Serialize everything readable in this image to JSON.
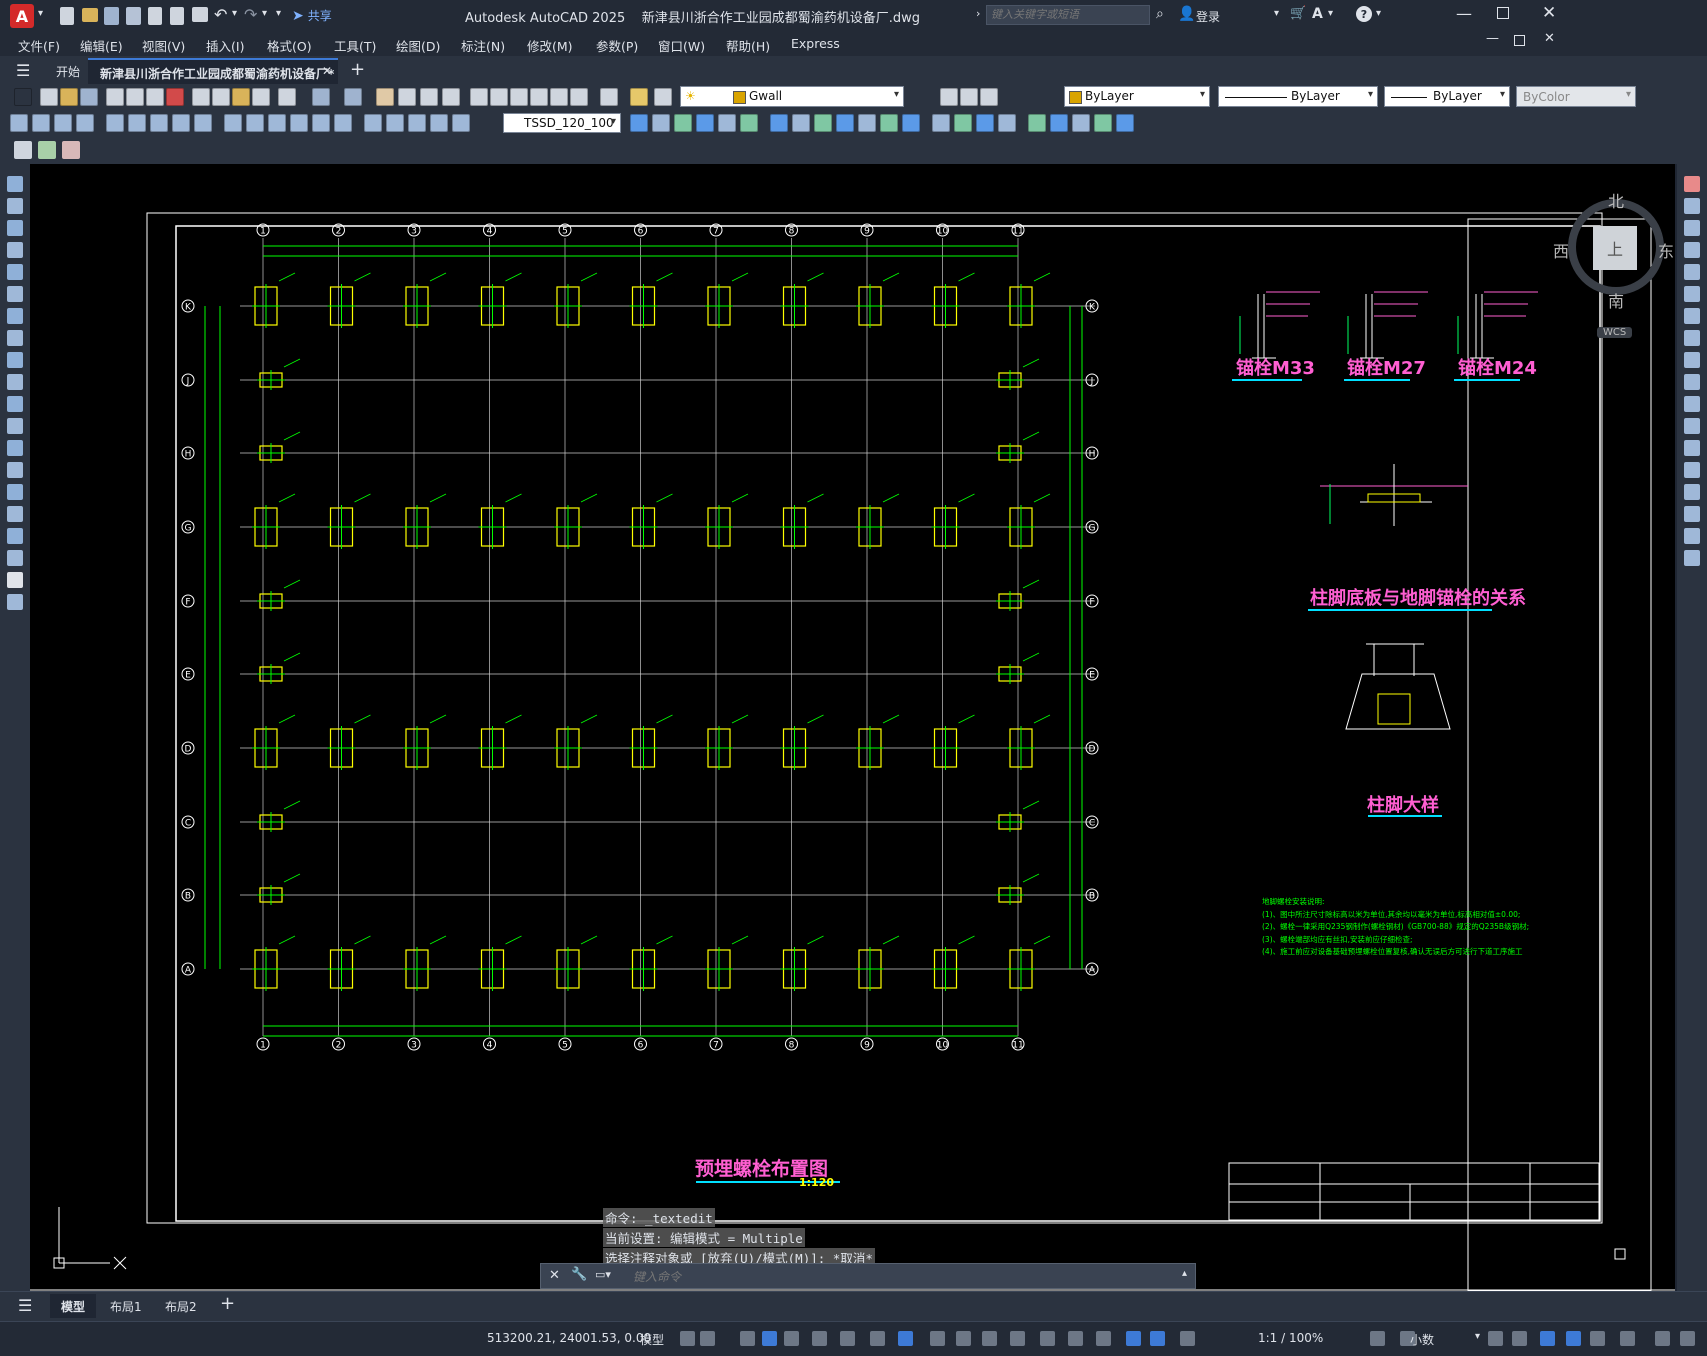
{
  "app": {
    "logo_letter": "A",
    "share_label": "共享",
    "title": "Autodesk AutoCAD 2025    新津县川浙合作工业园成都蜀渝药机设备厂.dwg",
    "search_placeholder": "键入关键字或短语",
    "login_label": "登录"
  },
  "menu": [
    "文件(F)",
    "编辑(E)",
    "视图(V)",
    "插入(I)",
    "格式(O)",
    "工具(T)",
    "绘图(D)",
    "标注(N)",
    "修改(M)",
    "参数(P)",
    "窗口(W)",
    "帮助(H)",
    "Express"
  ],
  "tabs": {
    "start": "开始",
    "doc": "新津县川浙合作工业园成都蜀渝药机设备厂*"
  },
  "toolbar": {
    "layer_name": "Gwall",
    "color": "ByLayer",
    "linetype": "ByLayer",
    "lineweight": "ByLayer",
    "plotstyle": "ByColor",
    "dimstyle": "TSSD_120_100"
  },
  "viewcube": {
    "north": "北",
    "south": "南",
    "east": "东",
    "west": "西",
    "top": "上",
    "wcs": "WCS"
  },
  "drawing": {
    "main_title": "预埋螺栓布置图",
    "main_scale": "1:120",
    "anchor_titles": [
      "锚栓M33",
      "锚栓M27",
      "锚栓M24"
    ],
    "detail1_title": "柱脚底板与地脚锚栓的关系",
    "detail2_title": "柱脚大样",
    "col_labels": [
      "1",
      "2",
      "3",
      "4",
      "5",
      "6",
      "7",
      "8",
      "9",
      "10",
      "11"
    ],
    "row_labels": [
      "K",
      "J",
      "H",
      "G",
      "F",
      "E",
      "D",
      "C",
      "B",
      "A"
    ],
    "notes": [
      "地脚螺栓安装说明:",
      "(1)、图中所注尺寸除标高以米为单位,其余均以毫米为单位,标高相对值±0.00;",
      "(2)、螺栓一律采用Q235钢制作(螺栓钢材)《GB700-88》规定的Q235B级钢材;",
      "(3)、螺栓端部均应有丝扣,安装前应仔细检查;",
      "(4)、施工前应对设备基础预埋螺栓位置复核,确认无误后方可进行下道工序施工"
    ]
  },
  "commandline": {
    "history": [
      "命令: _textedit",
      "当前设置: 编辑模式 = Multiple",
      "选择注释对象或 [放弃(U)/模式(M)]: *取消*"
    ],
    "placeholder": "键入命令"
  },
  "layout_tabs": [
    "模型",
    "布局1",
    "布局2"
  ],
  "status": {
    "coords": "513200.21, 24001.53, 0.00",
    "model": "模型",
    "scale": "1:1 / 100%",
    "units": "小数"
  },
  "colors": {
    "accent_pink": "#ff5fd2",
    "grid_green": "#00ff00",
    "column_yellow": "#ffff00"
  }
}
